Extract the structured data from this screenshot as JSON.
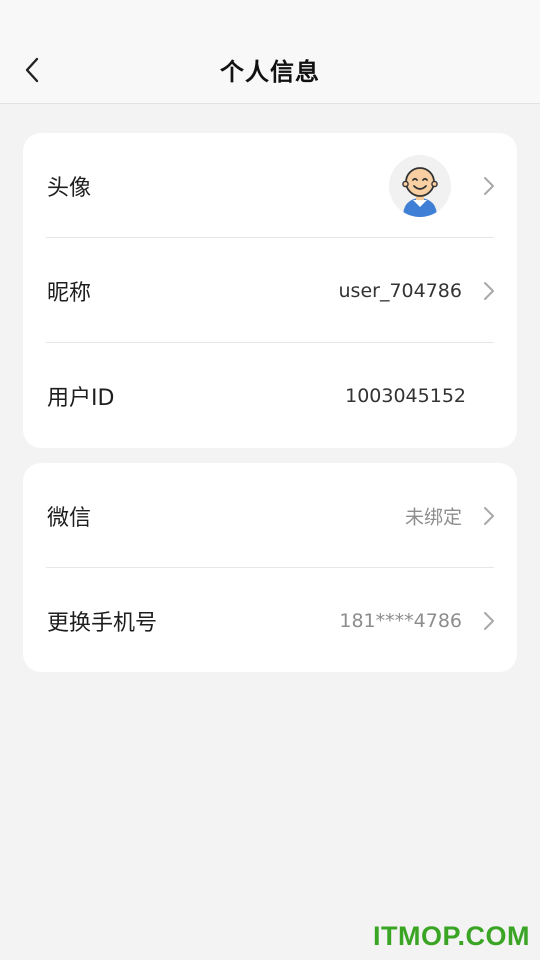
{
  "header": {
    "title": "个人信息"
  },
  "profile": {
    "avatar_label": "头像",
    "nickname_label": "昵称",
    "nickname_value": "user_704786",
    "user_id_label": "用户ID",
    "user_id_value": "1003045152"
  },
  "bindings": {
    "wechat_label": "微信",
    "wechat_value": "未绑定",
    "phone_label": "更换手机号",
    "phone_value": "181****4786"
  },
  "watermark": "ITMOP.COM",
  "icons": [
    "back-arrow-icon",
    "avatar-icon",
    "chevron-right-icon"
  ],
  "colors": {
    "background": "#f3f3f3",
    "card": "#ffffff",
    "muted_text": "#8d8d8d",
    "watermark": "#3aa424"
  }
}
